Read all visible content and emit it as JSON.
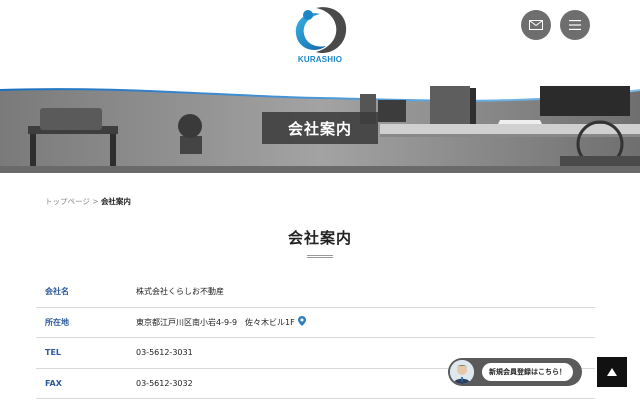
{
  "header": {
    "logo_text": "KURASHIO",
    "mail_icon": "mail-icon",
    "menu_icon": "hamburger-menu-icon"
  },
  "hero": {
    "title": "会社案内"
  },
  "breadcrumb": {
    "home": "トップページ",
    "separator": ">",
    "current": "会社案内"
  },
  "page": {
    "title": "会社案内"
  },
  "company_info": [
    {
      "label": "会社名",
      "value": "株式会社くらしお不動産"
    },
    {
      "label": "所在地",
      "value": "東京都江戸川区南小岩4-9-9　佐々木ビル1F"
    },
    {
      "label": "TEL",
      "value": "03-5612-3031"
    },
    {
      "label": "FAX",
      "value": "03-5612-3032"
    }
  ],
  "cta": {
    "label": "新規会員登録はこちら！"
  },
  "colors": {
    "label_blue": "#2d5b9b",
    "logo_blue": "#1a86c8",
    "button_gray": "#6e6e6e"
  }
}
